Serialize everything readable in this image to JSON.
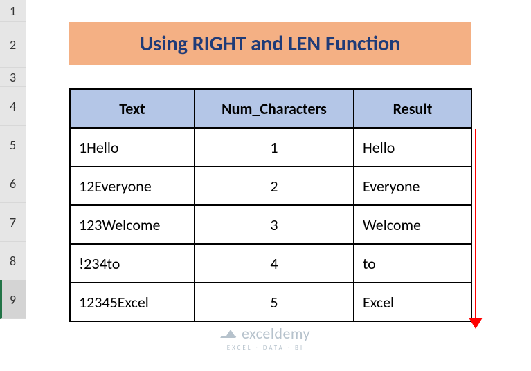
{
  "row_headers": [
    "1",
    "2",
    "3",
    "4",
    "5",
    "6",
    "7",
    "8",
    "9"
  ],
  "title": "Using RIGHT and LEN Function",
  "headers": {
    "text": "Text",
    "num": "Num_Characters",
    "result": "Result"
  },
  "rows": [
    {
      "text": "1Hello",
      "num": "1",
      "result": "Hello"
    },
    {
      "text": "12Everyone",
      "num": "2",
      "result": "Everyone"
    },
    {
      "text": "123Welcome",
      "num": "3",
      "result": "Welcome"
    },
    {
      "text": "!234to",
      "num": "4",
      "result": "to"
    },
    {
      "text": "12345Excel",
      "num": "5",
      "result": "Excel"
    }
  ],
  "watermark": {
    "brand": "exceldemy",
    "tagline": "EXCEL · DATA · BI"
  },
  "chart_data": {
    "type": "table",
    "title": "Using RIGHT and LEN Function",
    "columns": [
      "Text",
      "Num_Characters",
      "Result"
    ],
    "rows": [
      [
        "1Hello",
        1,
        "Hello"
      ],
      [
        "12Everyone",
        2,
        "Everyone"
      ],
      [
        "123Welcome",
        3,
        "Welcome"
      ],
      [
        "!234to",
        4,
        "to"
      ],
      [
        "12345Excel",
        5,
        "Excel"
      ]
    ]
  }
}
